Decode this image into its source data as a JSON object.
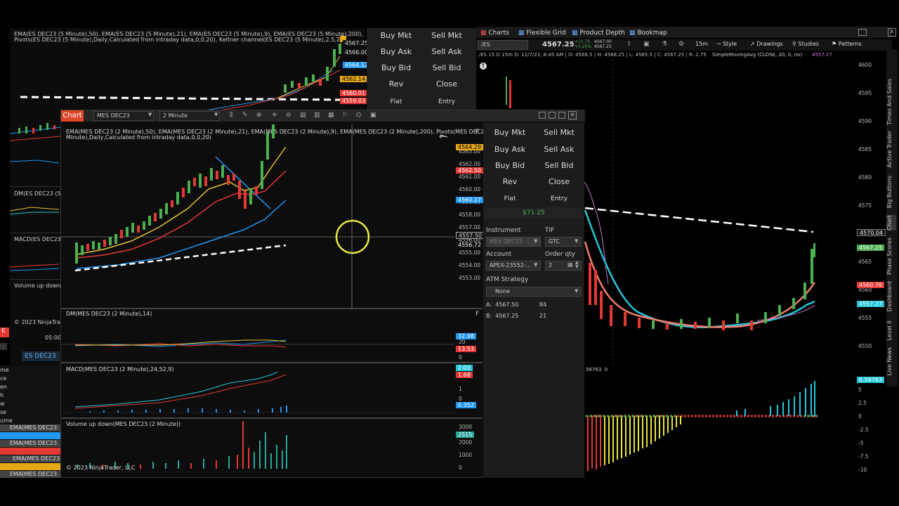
{
  "bg_chart": {
    "title_line1": "EMA(ES DEC23 (5 Minute),50), EMA(ES DEC23 (5 Minute),21), EMA(ES DEC23 (5 Minute),9), EMA(ES DEC23 (5 Minute),200),",
    "title_line2": "Pivots(ES DEC23 (5 Minute),Daily,Calculated from intraday data,0,0,20), Keltner channel(ES DEC23 (5 Minute),2.5,20)",
    "dm_label": "DM(ES DEC23 (5 M",
    "macd_label": "MACD(ES DEC23",
    "vol_label": "Volume up down(E",
    "copyright": "© 2023 NinjaTrade",
    "time_label": "05:00",
    "price_tags": [
      "4567.25",
      "4566.00",
      "4564.12",
      "4562.14",
      "4560.01",
      "4559.03"
    ],
    "instrument_tab": "ES DEC23"
  },
  "bg_buttons": {
    "buy_mkt": "Buy Mkt",
    "sell_mkt": "Sell Mkt",
    "buy_ask": "Buy Ask",
    "sell_ask": "Sell Ask",
    "buy_bid": "Buy Bid",
    "sell_bid": "Sell Bid",
    "rev": "Rev",
    "close": "Close",
    "flat": "Flat",
    "entry": "Entry"
  },
  "left_list": {
    "rows": [
      "me",
      "ce",
      "en",
      "h",
      "w",
      "se",
      "ume"
    ],
    "ema1": "EMA(MES DEC23",
    "ema2": "EMA(MES DEC23",
    "ema3": "EMA(MES DEC23",
    "ema4": "EMA(MES DEC23"
  },
  "top_tabs": {
    "charts": "Charts",
    "flexible_grid": "Flexible Grid",
    "product_depth": "Product Depth",
    "bookmap": "Bookmap"
  },
  "right_chart": {
    "symbol": "/ES",
    "price": "4567.25",
    "change_up": "+11.75",
    "change_pct": "+0.25%",
    "bid_small": "4567.00",
    "ask_small": "4567.25",
    "timeframe": "15m",
    "toolbar": {
      "style": "Style",
      "drawings": "Drawings",
      "studies": "Studies",
      "patterns": "Patterns"
    },
    "info_bar": "/ES 15 D 15m   D: 12/7/23, 8:45 AM  | O: 4566.5 | H: 4568.25 | L: 4565.5 | C: 4567.25 | R: 2.75",
    "sma_label": "SimpleMovingAvg (CLOSE, 20, 0, no)",
    "sma_value": "4557.27",
    "y_ticks": [
      "4600",
      "4595",
      "4590",
      "4585",
      "4580",
      "4575",
      "4570",
      "4565",
      "4560",
      "4555",
      "4550"
    ],
    "tags": {
      "t1": "4570.04",
      "t2": "4567.25",
      "t3": "4560.76",
      "t4": "4557.27"
    },
    "osc_value": "56763",
    "osc_zero": "0",
    "osc_ticks": [
      "5",
      "2.5",
      "0",
      "-2.5",
      "-5",
      "-7.5",
      "-10"
    ],
    "osc_tag": "6.56763",
    "side_tabs": [
      "Times And Sales",
      "Active Trader",
      "Big Buttons",
      "Chart",
      "Phase Scores",
      "Dashboard",
      "Level II",
      "Live News"
    ]
  },
  "main_chart": {
    "window_tab": "Chart",
    "instrument": "MES DEC23",
    "interval": "2 Minute",
    "title_line1": "EMA(MES DEC23 (2 Minute),50), EMA(MES DEC23 (2 Minute),21), EMA(MES DEC23 (2 Minute),9), EMA(MES DEC23 (2 Minute),200), Pivots(MES DEC23 (2",
    "title_line2": "Minute),Daily,Calculated from intraday data,0,0,20)",
    "y_ticks": [
      "4563.00",
      "4562.00",
      "4561.00",
      "4560.00",
      "4559.00",
      "4558.00",
      "4557.00",
      "4556.00",
      "4555.00",
      "4554.00",
      "4553.00"
    ],
    "tags": {
      "t1": "4564.29",
      "t2": "4562.50",
      "t3": "4560.27",
      "t4": "4557.50",
      "t5": "4556.72"
    },
    "dm_label": "DM(MES DEC23 (2 Minute),14)",
    "dm_ticks": [
      "20",
      "0"
    ],
    "dm_tags": {
      "a": "32.98",
      "b": "13.53"
    },
    "macd_label": "MACD(MES DEC23 (2 Minute),24,52,9)",
    "macd_ticks": [
      "1",
      "0"
    ],
    "macd_tags": {
      "a": "2.03",
      "b": "1.68",
      "c": "0.352"
    },
    "vol_label": "Volume up down(MES DEC23 (2 Minute))",
    "vol_ticks": [
      "3000",
      "2000",
      "1000",
      "0"
    ],
    "vol_tag": "2515",
    "copyright": "© 2023 NinjaTrader, LLC",
    "pane_button": "F"
  },
  "order_panel": {
    "buy_mkt": "Buy Mkt",
    "sell_mkt": "Sell Mkt",
    "buy_ask": "Buy Ask",
    "sell_ask": "Sell Ask",
    "buy_bid": "Buy Bid",
    "sell_bid": "Sell Bid",
    "rev": "Rev",
    "close": "Close",
    "flat": "Flat",
    "entry": "Entry",
    "pnl": "$71.25",
    "instrument_label": "Instrument",
    "instrument_value": "MES DEC23",
    "tif_label": "TIF",
    "tif_value": "GTC",
    "account_label": "Account",
    "account_value": "APEX-23552-...",
    "qty_label": "Order qty",
    "qty_value": "2",
    "atm_label": "ATM Strategy",
    "atm_value": "None",
    "ask_label": "A:",
    "ask_price": "4567.50",
    "ask_size": "84",
    "bid_label": "B:",
    "bid_price": "4567.25",
    "bid_size": "21"
  },
  "colors": {
    "up": "#4caf50",
    "down": "#e53935",
    "ema_blue": "#2196f3",
    "ema_red": "#e53935",
    "ema_yellow": "#e6c230",
    "cyan": "#26c6da",
    "salmon": "#f47c6c"
  }
}
